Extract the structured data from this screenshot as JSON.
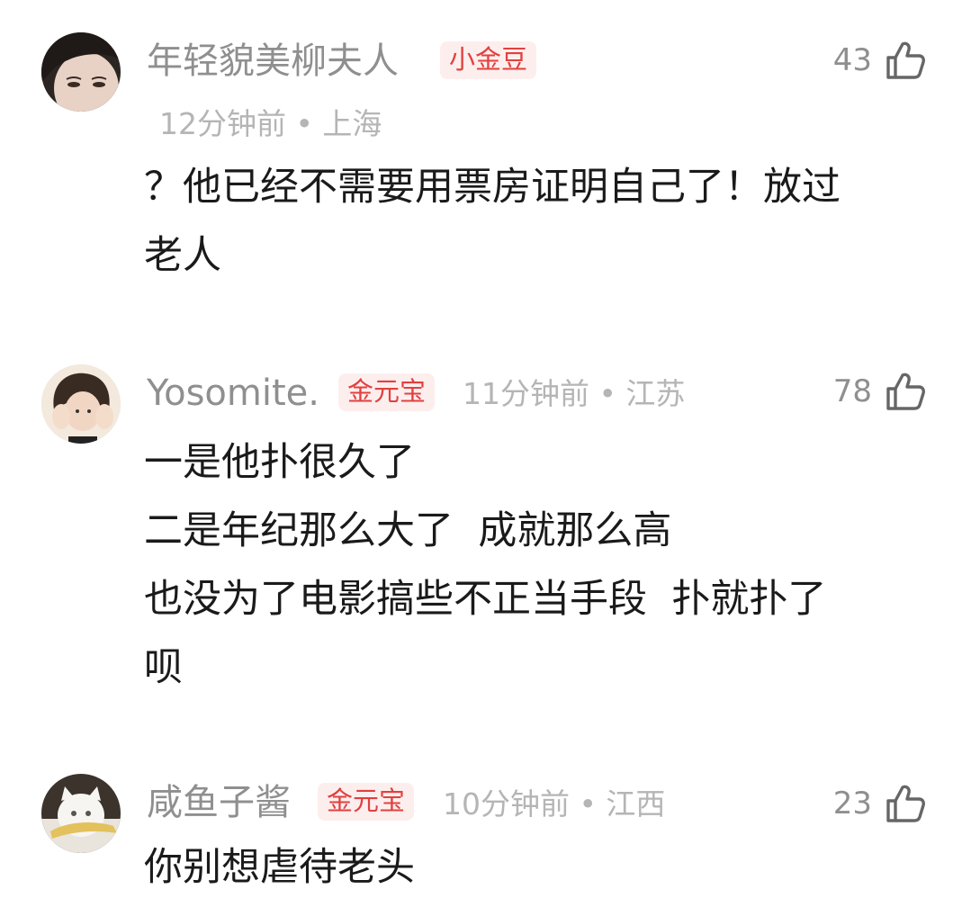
{
  "comments": [
    {
      "username": "年轻貌美柳夫人",
      "badge": "小金豆",
      "meta": "12分钟前 • 上海",
      "likes": "43",
      "text": "？他已经不需要用票房证明自己了！放过\n老人",
      "avatar_icon": "avatar-woman-face"
    },
    {
      "username": "Yosomite.",
      "badge": "金元宝",
      "meta": "11分钟前 • 江苏",
      "likes": "78",
      "text": "一是他扑很久了\n二是年纪那么大了  成就那么高\n也没为了电影搞些不正当手段  扑就扑了\n呗",
      "avatar_icon": "avatar-girl-hands-face"
    },
    {
      "username": "咸鱼子酱",
      "badge": "金元宝",
      "meta": "10分钟前 • 江西",
      "likes": "23",
      "text": "你别想虐待老头",
      "avatar_icon": "avatar-white-cat-fish"
    }
  ],
  "colors": {
    "badge_bg": "#fdeeee",
    "badge_text": "#e0413f",
    "username": "#8f8f8f",
    "meta": "#b5b5b5",
    "body": "#1a1a1a"
  }
}
